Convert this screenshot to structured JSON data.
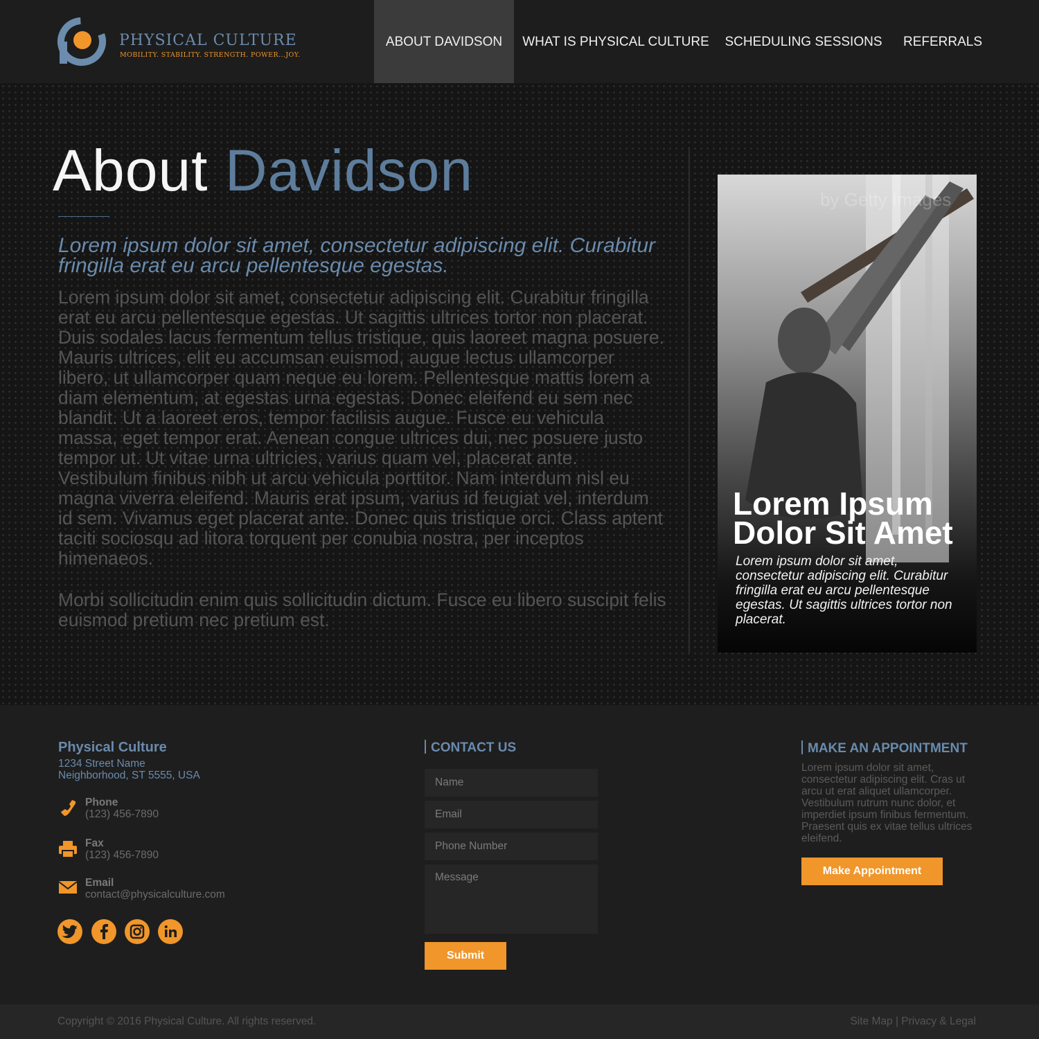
{
  "brand": {
    "name": "PHYSICAL CULTURE",
    "tagline": "MOBILITY. STABILITY. STRENGTH. POWER...JOY.",
    "colors": {
      "accent": "#f0962a",
      "blue": "#6a8bad",
      "dark": "#1d1d1d"
    }
  },
  "nav": {
    "items": [
      {
        "label": "ABOUT DAVIDSON",
        "active": true
      },
      {
        "label": "WHAT IS PHYSICAL CULTURE",
        "active": false
      },
      {
        "label": "SCHEDULING SESSIONS",
        "active": false
      },
      {
        "label": "REFERRALS",
        "active": false
      }
    ]
  },
  "main": {
    "title_part1": "About",
    "title_part2": "Davidson",
    "lead": "Lorem ipsum dolor sit amet, consectetur adipiscing elit. Curabitur fringilla erat eu arcu pellentesque egestas.",
    "paragraph1": "Lorem ipsum dolor sit amet, consectetur adipiscing elit. Curabitur fringilla erat eu arcu pellentesque egestas. Ut sagittis ultrices tortor non placerat. Duis sodales lacus fermentum tellus tristique, quis laoreet magna posuere. Mauris ultrices, elit eu accumsan euismod, augue lectus ullamcorper libero, ut ullamcorper quam neque eu lorem. Pellentesque mattis lorem a diam elementum, at egestas urna egestas. Donec eleifend eu sem nec blandit. Ut a laoreet eros, tempor facilisis augue. Fusce eu vehicula massa, eget tempor erat. Aenean congue ultrices dui, nec posuere justo tempor ut. Ut vitae urna ultricies, varius quam vel, placerat ante. Vestibulum finibus nibh ut arcu vehicula porttitor. Nam interdum nisl eu magna viverra eleifend. Mauris erat ipsum, varius id feugiat vel, interdum id sem. Vivamus eget placerat ante. Donec quis tristique orci. Class aptent taciti sociosqu ad litora torquent per conubia nostra, per inceptos himenaeos.",
    "paragraph2": "Morbi sollicitudin enim quis sollicitudin dictum. Fusce eu libero suscipit felis euismod pretium nec pretium est."
  },
  "card": {
    "heading": "Lorem Ipsum Dolor Sit Amet",
    "text": "Lorem ipsum dolor sit amet, consectetur adipiscing elit. Curabitur fringilla erat eu arcu pellentesque egestas. Ut sagittis ultrices tortor non placerat.",
    "watermark": "by Getty Images"
  },
  "footer": {
    "company": "Physical Culture",
    "address_line1": "1234 Street Name",
    "address_line2": "Neighborhood, ST 5555, USA",
    "phone_label": "Phone",
    "phone_value": "(123) 456-7890",
    "fax_label": "Fax",
    "fax_value": "(123) 456-7890",
    "email_label": "Email",
    "email_value": "contact@physicalculture.com",
    "social": [
      "twitter-icon",
      "facebook-icon",
      "instagram-icon",
      "linkedin-icon"
    ],
    "contact": {
      "title": "CONTACT US",
      "name_placeholder": "Name",
      "email_placeholder": "Email",
      "phone_placeholder": "Phone Number",
      "message_placeholder": "Message",
      "submit_label": "Submit"
    },
    "appointment": {
      "title": "MAKE AN APPOINTMENT",
      "text": "Lorem ipsum dolor sit amet, consectetur adipiscing elit. Cras ut arcu ut erat aliquet ullamcorper. Vestibulum rutrum nunc dolor, et imperdiet ipsum finibus fermentum. Praesent quis ex vitae tellus ultrices eleifend.",
      "button_label": "Make Appointment"
    }
  },
  "bottom": {
    "copyright": "Copyright © 2016 Physical Culture. All rights reserved.",
    "sitemap": "Site Map",
    "separator": "|",
    "legal": "Privacy & Legal"
  }
}
